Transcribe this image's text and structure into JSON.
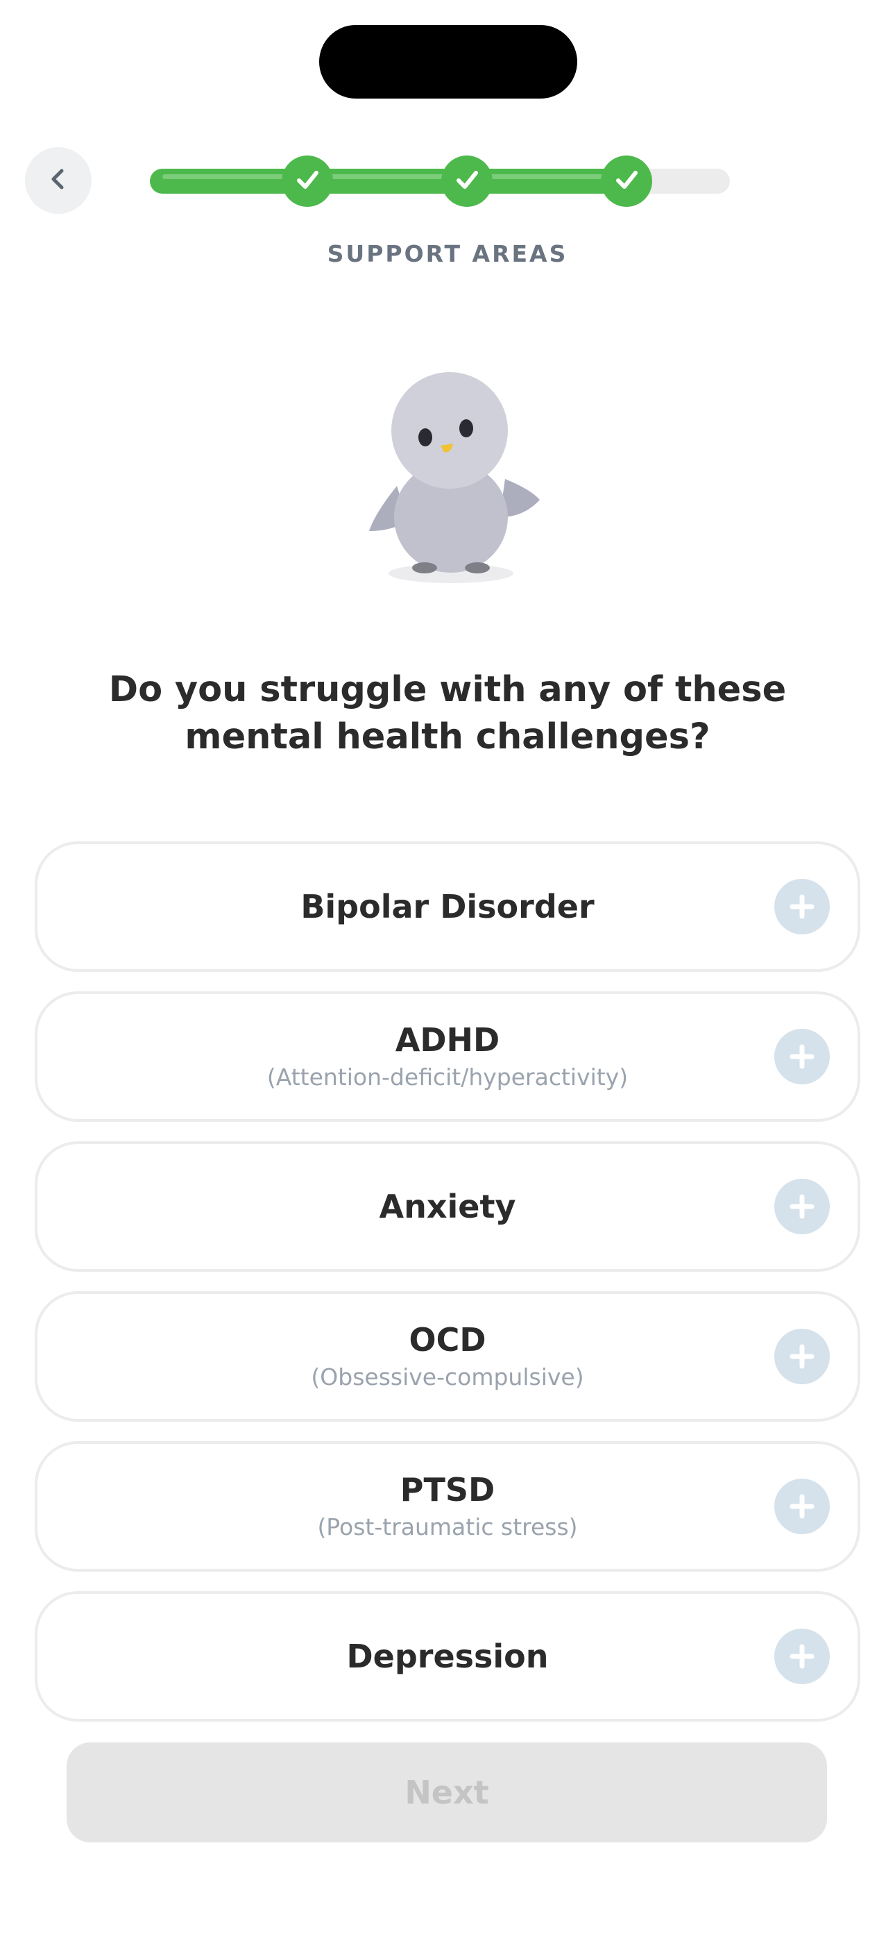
{
  "header": {
    "back_icon": "chevron-left-icon",
    "progress_fraction": 0.82,
    "completed_steps": 3,
    "section_label": "SUPPORT AREAS"
  },
  "mascot": {
    "icon": "penguin-mascot"
  },
  "question": "Do you struggle with any of these mental health challenges?",
  "options": [
    {
      "title": "Bipolar Disorder",
      "subtitle": ""
    },
    {
      "title": "ADHD",
      "subtitle": "(Attention-deficit/hyperactivity)"
    },
    {
      "title": "Anxiety",
      "subtitle": ""
    },
    {
      "title": "OCD",
      "subtitle": "(Obsessive-compulsive)"
    },
    {
      "title": "PTSD",
      "subtitle": "(Post-traumatic stress)"
    },
    {
      "title": "Depression",
      "subtitle": ""
    }
  ],
  "next_label": "Next",
  "colors": {
    "accent_green": "#4db94c",
    "plus_circle": "#d5e2eb",
    "disabled_button": "#e5e5e5"
  }
}
